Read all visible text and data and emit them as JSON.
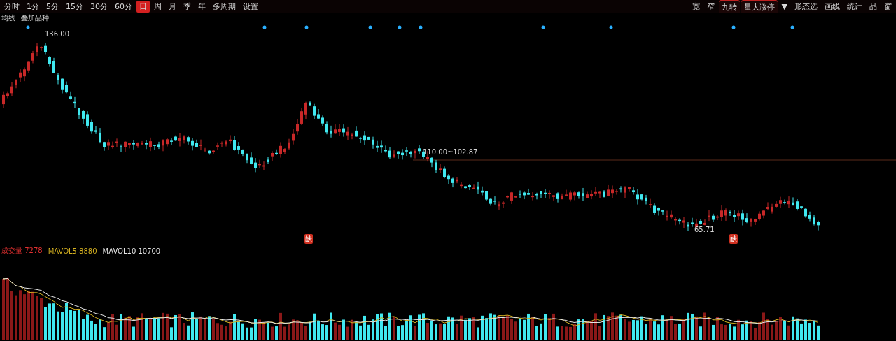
{
  "toolbar": {
    "tabs": [
      {
        "label": "分时",
        "selected": false
      },
      {
        "label": "1分",
        "selected": false
      },
      {
        "label": "5分",
        "selected": false
      },
      {
        "label": "15分",
        "selected": false
      },
      {
        "label": "30分",
        "selected": false
      },
      {
        "label": "60分",
        "selected": false
      },
      {
        "label": "日",
        "selected": true
      },
      {
        "label": "周",
        "selected": false
      },
      {
        "label": "月",
        "selected": false
      },
      {
        "label": "季",
        "selected": false
      },
      {
        "label": "年",
        "selected": false
      },
      {
        "label": "多周期",
        "selected": false
      },
      {
        "label": "设置",
        "selected": false
      }
    ],
    "right_items": [
      {
        "label": "宽",
        "kind": "plain"
      },
      {
        "label": "窄",
        "kind": "plain"
      },
      {
        "label": "九转",
        "kind": "tab"
      },
      {
        "label": "量大涨停",
        "kind": "tab"
      },
      {
        "label": "▼",
        "kind": "plain"
      },
      {
        "label": "形态选",
        "kind": "plain"
      },
      {
        "label": "画线",
        "kind": "plain"
      },
      {
        "label": "统计",
        "kind": "plain"
      },
      {
        "label": "品",
        "kind": "plain"
      },
      {
        "label": "窗",
        "kind": "plain"
      }
    ]
  },
  "subbar": [
    "均线",
    "叠加品种"
  ],
  "price_chart": {
    "high_label": "136.00",
    "range_label": "110.00~102.87",
    "low_label": "65.71",
    "gap_badges": [
      "缺",
      "缺"
    ]
  },
  "volume_header": [
    {
      "text": "成交量 7278",
      "color": "#e03030"
    },
    {
      "text": "MAVOL5 8880",
      "color": "#d4b020"
    },
    {
      "text": "MAVOL10 10700",
      "color": "#e8e8e8"
    }
  ]
}
